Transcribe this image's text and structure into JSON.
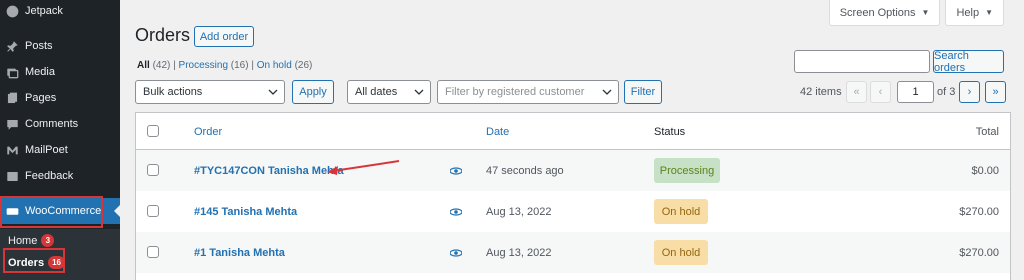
{
  "sidebar": {
    "items": [
      {
        "label": "Jetpack",
        "icon": "jetpack-icon"
      },
      {
        "label": "Posts",
        "icon": "pin-icon"
      },
      {
        "label": "Media",
        "icon": "media-icon"
      },
      {
        "label": "Pages",
        "icon": "pages-icon"
      },
      {
        "label": "Comments",
        "icon": "comment-icon"
      },
      {
        "label": "MailPoet",
        "icon": "mailpoet-icon"
      },
      {
        "label": "Feedback",
        "icon": "feedback-icon"
      },
      {
        "label": "WooCommerce",
        "icon": "woo-icon"
      }
    ],
    "submenu": [
      {
        "label": "Home",
        "count": "3"
      },
      {
        "label": "Orders",
        "count": "16"
      }
    ]
  },
  "header": {
    "screen_options": "Screen Options",
    "help": "Help",
    "title": "Orders",
    "add_order": "Add order"
  },
  "views": {
    "all": "All",
    "all_count": "(42)",
    "processing": "Processing",
    "processing_count": "(16)",
    "on_hold": "On hold",
    "on_hold_count": "(26)",
    "sep": "|"
  },
  "filters": {
    "bulk_actions": "Bulk actions",
    "apply": "Apply",
    "dates": "All dates",
    "customer_placeholder": "Filter by registered customer",
    "filter": "Filter",
    "search_button": "Search orders",
    "search_value": ""
  },
  "pagination": {
    "items": "42 items",
    "first": "«",
    "prev": "‹",
    "current": "1",
    "of": "of 3",
    "next": "›",
    "last": "»"
  },
  "table": {
    "columns": {
      "order": "Order",
      "date": "Date",
      "status": "Status",
      "total": "Total"
    },
    "rows": [
      {
        "order": "#TYC147CON Tanisha Mehta",
        "date": "47 seconds ago",
        "status": "Processing",
        "total": "$0.00"
      },
      {
        "order": "#145 Tanisha Mehta",
        "date": "Aug 13, 2022",
        "status": "On hold",
        "total": "$270.00"
      },
      {
        "order": "#1 Tanisha Mehta",
        "date": "Aug 13, 2022",
        "status": "On hold",
        "total": "$270.00"
      }
    ]
  },
  "colors": {
    "accent": "#2271b1",
    "sidebar_bg": "#1d2327",
    "annotation_red": "#d63638",
    "processing_bg": "#c6e1c6",
    "onhold_bg": "#f8dda7"
  }
}
